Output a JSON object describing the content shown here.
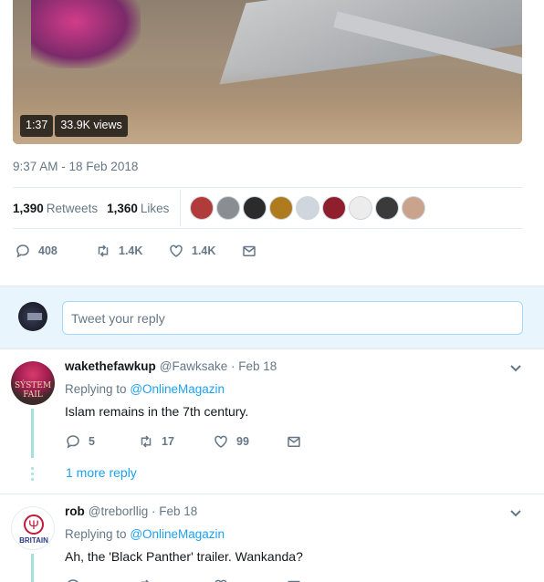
{
  "video": {
    "duration": "1:37",
    "views": "33.9K views"
  },
  "tweet": {
    "timestamp": "9:37 AM - 18 Feb 2018",
    "retweets_count": "1,390",
    "retweets_label": "Retweets",
    "likes_count": "1,360",
    "likes_label": "Likes",
    "reply_count": "408",
    "retweet_count_short": "1.4K",
    "like_count_short": "1.4K"
  },
  "likers_avatar_colors": [
    "#b13b3b",
    "#8a8d92",
    "#2b2b2b",
    "#b07a1e",
    "#cfd6dd",
    "#8f1f2c",
    "#ececec",
    "#3a3a3a",
    "#c9a38c"
  ],
  "reply_box": {
    "placeholder": "Tweet your reply"
  },
  "replies": [
    {
      "display_name": "wakethefawkup",
      "handle": "@Fawksake",
      "date": "· Feb 18",
      "replying_prefix": "Replying to",
      "replying_to": "@OnlineMagazin",
      "text": "Islam remains in the 7th century.",
      "reply_count": "5",
      "retweet_count": "17",
      "like_count": "99",
      "more_replies": "1 more reply",
      "avatar_text": "SÝSTEM FAIL"
    },
    {
      "display_name": "rob",
      "handle": "@treborllig",
      "date": "· Feb 18",
      "replying_prefix": "Replying to",
      "replying_to": "@OnlineMagazin",
      "text": "Ah, the 'Black Panther' trailer. Wankanda?",
      "avatar_text": "BRITAIN"
    }
  ],
  "colors": {
    "accent": "#1da1f2",
    "muted": "#657786",
    "thread": "#a3e0de",
    "reply_bg": "#e8f5fd"
  }
}
